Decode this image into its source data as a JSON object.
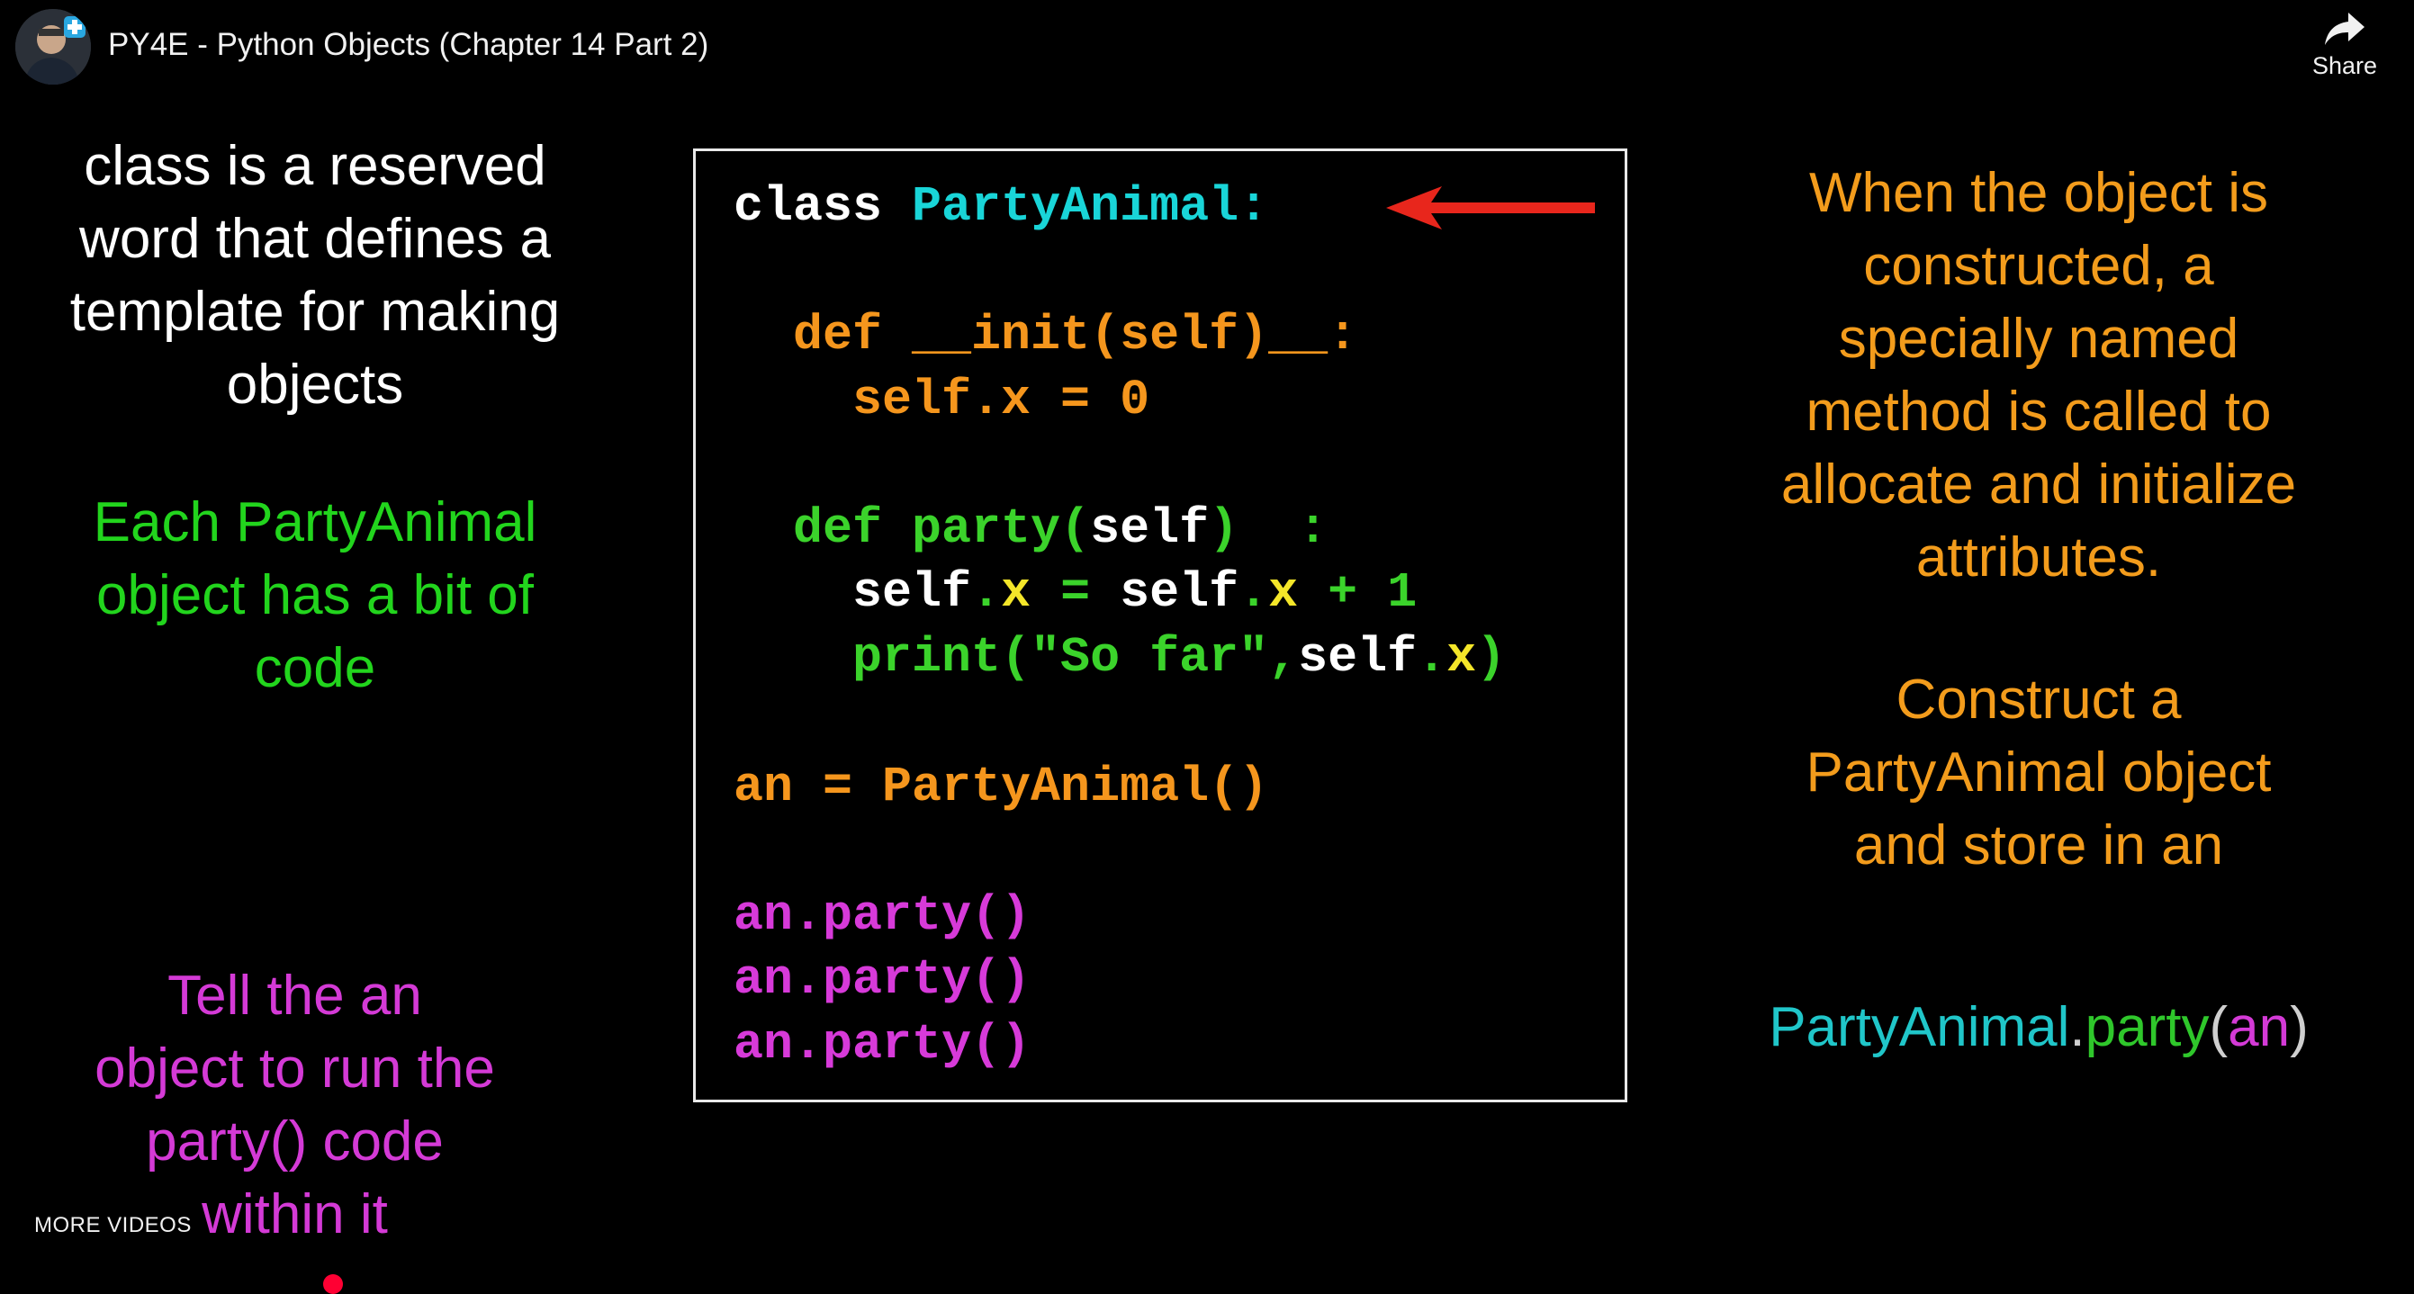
{
  "header": {
    "title": "PY4E - Python Objects (Chapter 14 Part 2)",
    "share_label": "Share",
    "more_videos_label": "MORE VIDEOS"
  },
  "slide": {
    "left": {
      "class_note": [
        "class is a reserved",
        "word  that defines a",
        "template for making",
        "objects"
      ],
      "each_note": [
        "Each PartyAnimal",
        "object has a bit of",
        "code"
      ],
      "tell_note": [
        "Tell the an",
        "object to run the",
        "party() code",
        "within it"
      ]
    },
    "right": {
      "constructed_note": [
        "When the object is",
        "constructed, a",
        "specially named",
        "method is called to",
        "allocate and initialize",
        "attributes."
      ],
      "construct_note": [
        "Construct a",
        "PartyAnimal object",
        "and store in an"
      ],
      "call_form": {
        "cls": "PartyAnimal",
        "dot": ".",
        "method": "party",
        "open": "(",
        "arg": "an",
        "close": ")"
      }
    },
    "code": {
      "line1": {
        "kw": "class ",
        "name": "PartyAnimal:"
      },
      "line2": {
        "text": "  def __init(self)__:"
      },
      "line3": {
        "text": "    self.x = 0"
      },
      "line4": {
        "def": "  def party(",
        "self": "self",
        "close": ")  :"
      },
      "line5": {
        "self1": "    self",
        "dot1": ".",
        "x1": "x",
        "eq": " = ",
        "self2": "self",
        "dot2": ".",
        "x2": "x",
        "rest": " + 1"
      },
      "line6": {
        "print": "    print(\"So far\",",
        "self": "self",
        "dot": ".",
        "x": "x",
        "close": ")"
      },
      "line7": {
        "text": "an = PartyAnimal()"
      },
      "line8": {
        "text": "an.party()"
      },
      "line9": {
        "text": "an.party()"
      },
      "line10": {
        "text": "an.party()"
      }
    }
  },
  "colors": {
    "green": "#22d51d",
    "magenta": "#d43ad6",
    "orange": "#f39c1c",
    "cyan": "#20c6c9",
    "arrow_red": "#e8261c",
    "progress_red": "#ff0033"
  },
  "icons": {
    "share": "share-arrow-icon",
    "arrow": "red-arrow-icon",
    "avatar": "channel-avatar"
  }
}
